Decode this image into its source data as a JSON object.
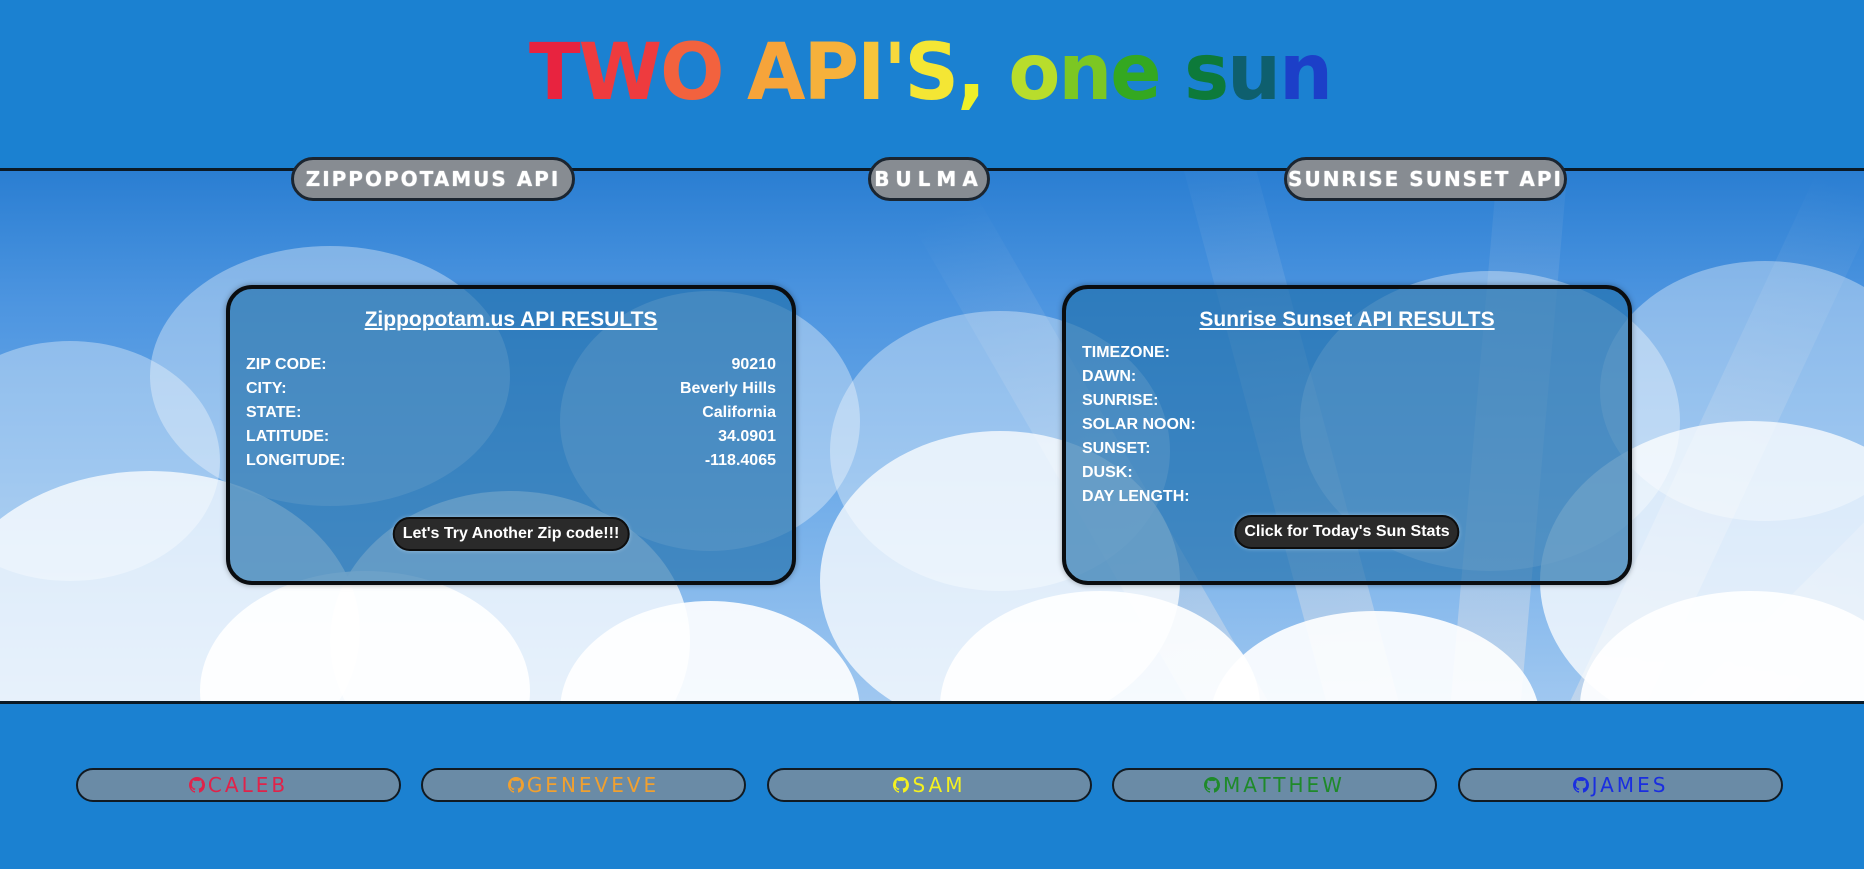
{
  "header": {
    "title_parts": [
      "TWO ",
      "API'S, ",
      "one ",
      "sun"
    ],
    "title_letters": [
      {
        "ch": "T",
        "color": "#e8233f"
      },
      {
        "ch": "W",
        "color": "#ee3b3e"
      },
      {
        "ch": "O",
        "color": "#f2623e"
      },
      {
        "ch": " ",
        "color": "#ffffff"
      },
      {
        "ch": "A",
        "color": "#f6a43a"
      },
      {
        "ch": "P",
        "color": "#f6b13b"
      },
      {
        "ch": "I",
        "color": "#f7c53b"
      },
      {
        "ch": "'",
        "color": "#f8d83c"
      },
      {
        "ch": "S",
        "color": "#f4e634"
      },
      {
        "ch": ",",
        "color": "#eef029"
      },
      {
        "ch": " ",
        "color": "#ffffff"
      },
      {
        "ch": "o",
        "color": "#b8dd2c"
      },
      {
        "ch": "n",
        "color": "#7cc723"
      },
      {
        "ch": "e",
        "color": "#34a820"
      },
      {
        "ch": " ",
        "color": "#ffffff"
      },
      {
        "ch": "s",
        "color": "#0d7a3a"
      },
      {
        "ch": "u",
        "color": "#0e5f6e"
      },
      {
        "ch": "n",
        "color": "#1c3fc8"
      }
    ]
  },
  "nav": {
    "zippo": "ZIPPOPOTAMUS API",
    "bulma": "BULMA",
    "sunrise": "SUNRISE SUNSET API"
  },
  "zip_card": {
    "title": "Zippopotam.us API RESULTS",
    "rows": [
      {
        "label": "ZIP CODE:",
        "value": "90210"
      },
      {
        "label": "CITY:",
        "value": "Beverly Hills"
      },
      {
        "label": "STATE:",
        "value": "California"
      },
      {
        "label": "LATITUDE:",
        "value": "34.0901"
      },
      {
        "label": "LONGITUDE:",
        "value": "-118.4065"
      }
    ],
    "button": "Let's Try Another Zip code!!!"
  },
  "sun_card": {
    "title": "Sunrise Sunset API RESULTS",
    "rows": [
      {
        "label": "TIMEZONE:",
        "value": ""
      },
      {
        "label": "DAWN:",
        "value": ""
      },
      {
        "label": "SUNRISE:",
        "value": ""
      },
      {
        "label": "SOLAR NOON:",
        "value": ""
      },
      {
        "label": "SUNSET:",
        "value": ""
      },
      {
        "label": "DUSK:",
        "value": ""
      },
      {
        "label": "DAY LENGTH:",
        "value": ""
      }
    ],
    "button": "Click for Today's Sun Stats"
  },
  "footer": {
    "links": [
      {
        "name": "CALEB",
        "color": "#e0234a",
        "icon": "github-icon"
      },
      {
        "name": "GENEVEVE",
        "color": "#f0a030",
        "icon": "github-icon"
      },
      {
        "name": "SAM",
        "color": "#f4f020",
        "icon": "github-icon"
      },
      {
        "name": "MATTHEW",
        "color": "#1e8a2a",
        "icon": "github-icon"
      },
      {
        "name": "JAMES",
        "color": "#1a2ee0",
        "icon": "github-icon"
      }
    ]
  },
  "colors": {
    "page_bg": "#1b81d1",
    "pill_bg": "#878c92",
    "footer_btn_bg": "#6a8ba6"
  }
}
